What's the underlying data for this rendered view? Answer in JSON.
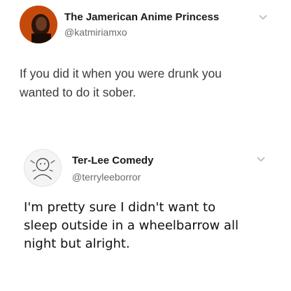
{
  "tweets": [
    {
      "display_name": "The Jamerican Anime Princess",
      "handle": "@katmiriamxo",
      "text_lines": [
        "If you did it when you were drunk you",
        "wanted to do it sober."
      ],
      "avatar_color": "#c44a0c"
    },
    {
      "display_name": "Ter-Lee Comedy",
      "handle": "@terryleeborror",
      "text_lines": [
        "I'm pretty sure I didn't want to",
        "sleep outside in a wheelbarrow all",
        "night but alright."
      ],
      "avatar_color": "#f4f4f4"
    }
  ],
  "icons": {
    "menu": "chevron-down-icon"
  },
  "colors": {
    "handle_gray": "#6b6b6b",
    "chevron_gray": "#b8b8b8"
  }
}
